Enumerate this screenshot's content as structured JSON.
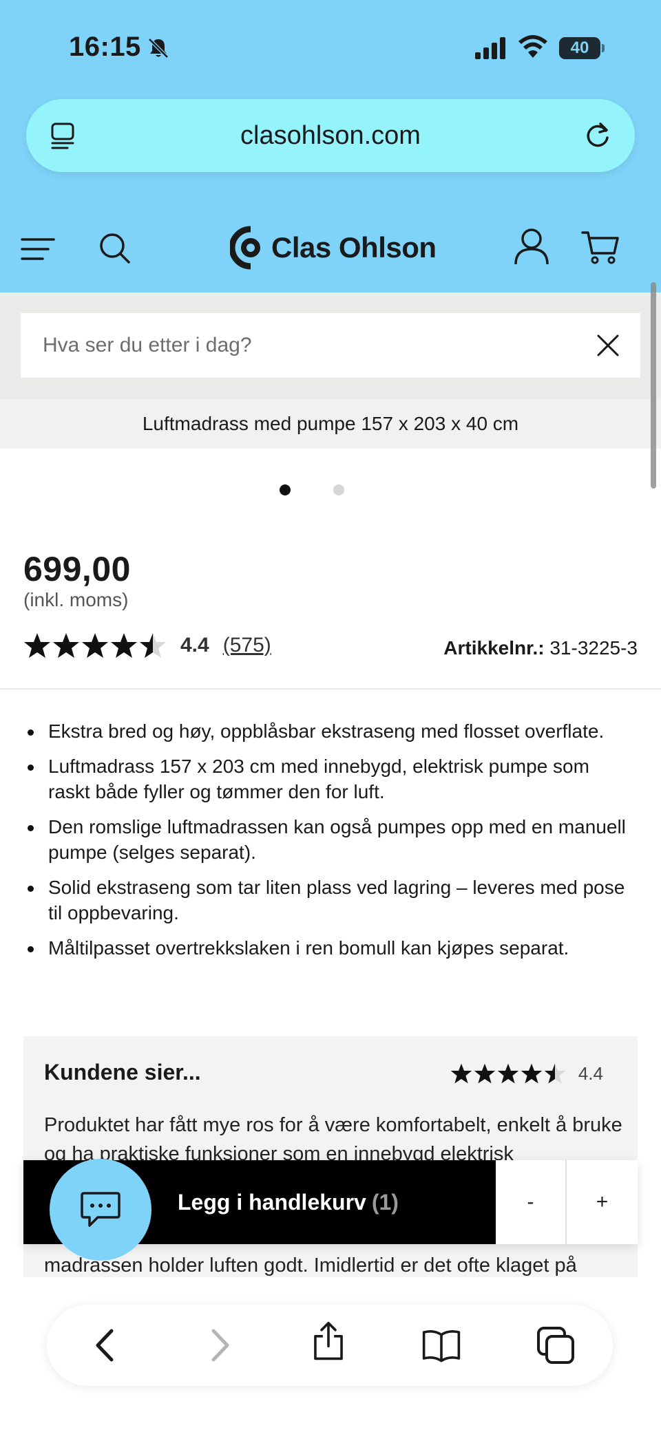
{
  "status_bar": {
    "time": "16:15",
    "battery_level": "40",
    "icons": [
      "bell-slash-icon",
      "cellular-signal-icon",
      "wifi-icon",
      "battery-icon"
    ]
  },
  "browser": {
    "url": "clasohlson.com",
    "left_icon": "page-menu-icon",
    "right_icon": "reload-icon",
    "toolbar_icons": [
      "back-icon",
      "forward-icon",
      "share-icon",
      "bookmarks-icon",
      "tabs-icon"
    ]
  },
  "site_header": {
    "brand": "Clas Ohlson",
    "accent_color": "#7fd3f8",
    "icons": [
      "menu-icon",
      "search-icon",
      "account-icon",
      "cart-icon"
    ]
  },
  "search": {
    "placeholder": "Hva ser du etter i dag?",
    "value": ""
  },
  "product": {
    "title": "Luftmadrass med pumpe 157 x 203 x 40 cm",
    "image_count": 2,
    "active_image": 1,
    "price": "699,00",
    "vat_note": "(inkl. moms)",
    "rating": "4.4",
    "rating_value": 4.4,
    "review_count": "(575)",
    "article_label": "Artikkelnr.:",
    "article_number": "31-3225-3",
    "bullets": [
      "Ekstra bred og høy, oppblåsbar ekstraseng med flosset overflate.",
      "Luftmadrass 157 x 203 cm med innebygd, elektrisk pumpe som raskt både fyller og tømmer den for luft.",
      "Den romslige luftmadrassen kan også pumpes opp med en manuell pumpe (selges separat).",
      "Solid ekstraseng som tar liten plass ved lagring – leveres med pose til oppbevaring.",
      "Måltilpasset overtrekkslaken i ren bomull kan kjøpes separat."
    ]
  },
  "reviews": {
    "title": "Kundene sier...",
    "rating": "4.4",
    "rating_value": 4.4,
    "text": "Produktet har fått mye ros for å være komfortabelt, enkelt å bruke og ha praktiske funksjoner som en innebygd elektrisk",
    "text_tail": "madrassen holder luften godt. Imidlertid er det ofte klaget på"
  },
  "cart_bar": {
    "add_label": "Legg i handlekurv",
    "count": "(1)",
    "minus": "-",
    "plus": "+"
  }
}
